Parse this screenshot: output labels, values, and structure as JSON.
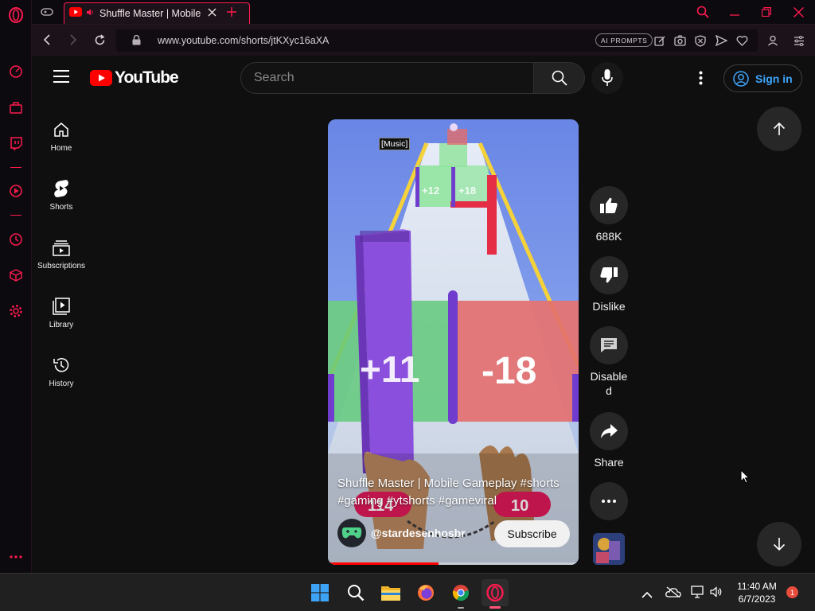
{
  "browser": {
    "tab": {
      "title": "Shuffle Master | Mobile Gameplay #shorts"
    },
    "address": {
      "url": "www.youtube.com/shorts/jtKXyc16aXA",
      "ai_prompts_label": "AI PROMPTS"
    },
    "accent_color": "#ff1a4f"
  },
  "youtube": {
    "logo": "YouTube",
    "search": {
      "placeholder": "Search"
    },
    "sign_in_label": "Sign in",
    "guide": [
      {
        "label": "Home",
        "icon": "home-icon"
      },
      {
        "label": "Shorts",
        "icon": "shorts-icon"
      },
      {
        "label": "Subscriptions",
        "icon": "subscriptions-icon"
      },
      {
        "label": "Library",
        "icon": "library-icon"
      },
      {
        "label": "History",
        "icon": "history-icon"
      }
    ],
    "short": {
      "caption": "[Music]",
      "title": "Shuffle Master | Mobile Gameplay #shorts #gaming #ytshorts #gameviral",
      "channel": "@stardesenhosbr",
      "subscribe_label": "Subscribe",
      "progress": 0.44,
      "game_text": {
        "left_gate": "+11",
        "right_gate": "-18",
        "top_gate_1": "+12",
        "top_gate_2": "+18",
        "stack_count": "114",
        "hand_count": "10"
      }
    },
    "actions": {
      "like_count": "688K",
      "dislike_label": "Dislike",
      "comments_label_1": "Disable",
      "comments_label_2": "d",
      "share_label": "Share"
    }
  },
  "taskbar": {
    "time": "11:40 AM",
    "date": "6/7/2023",
    "notification_count": "1"
  }
}
